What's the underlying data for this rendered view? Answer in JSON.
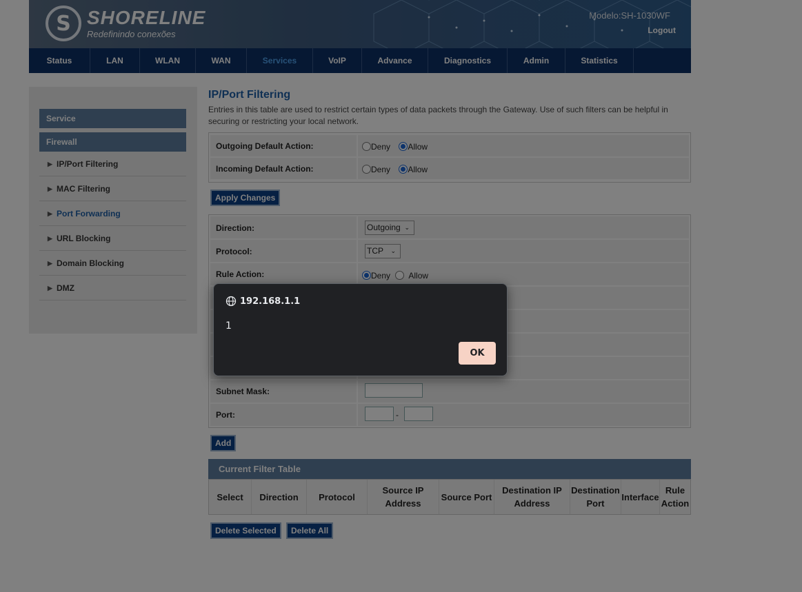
{
  "header": {
    "brand_name": "SHORELINE",
    "brand_tagline": "Redefinindo conexões",
    "model": "Modelo:SH-1030WF",
    "logout": "Logout"
  },
  "nav": [
    {
      "label": "Status"
    },
    {
      "label": "LAN"
    },
    {
      "label": "WLAN"
    },
    {
      "label": "WAN"
    },
    {
      "label": "Services"
    },
    {
      "label": "VoIP"
    },
    {
      "label": "Advance"
    },
    {
      "label": "Diagnostics"
    },
    {
      "label": "Admin"
    },
    {
      "label": "Statistics"
    }
  ],
  "sidebar": {
    "section": "Service",
    "group": "Firewall",
    "items": [
      {
        "label": "IP/Port Filtering"
      },
      {
        "label": "MAC Filtering"
      },
      {
        "label": "Port Forwarding"
      },
      {
        "label": "URL Blocking"
      },
      {
        "label": "Domain Blocking"
      },
      {
        "label": "DMZ"
      }
    ]
  },
  "main": {
    "title": "IP/Port Filtering",
    "description": "Entries in this table are used to restrict certain types of data packets through the Gateway. Use of such filters can be helpful in securing or restricting your local network.",
    "outgoing_label": "Outgoing Default Action:",
    "incoming_label": "Incoming Default Action:",
    "deny": "Deny",
    "allow": "Allow",
    "apply_button": "Apply Changes",
    "direction_label": "Direction:",
    "direction_value": "Outgoing",
    "protocol_label": "Protocol:",
    "protocol_value": "TCP",
    "rule_action_label": "Rule Action:",
    "subnet_label": "Subnet Mask:",
    "port_label": "Port:",
    "port_sep": "-",
    "add_button": "Add",
    "table_title": "Current Filter Table",
    "columns": [
      "Select",
      "Direction",
      "Protocol",
      "Source IP Address",
      "Source Port",
      "Destination IP Address",
      "Destination Port",
      "Interface",
      "Rule Action"
    ],
    "delete_selected": "Delete Selected",
    "delete_all": "Delete All"
  },
  "dialog": {
    "origin": "192.168.1.1",
    "message": "1",
    "ok": "OK"
  }
}
